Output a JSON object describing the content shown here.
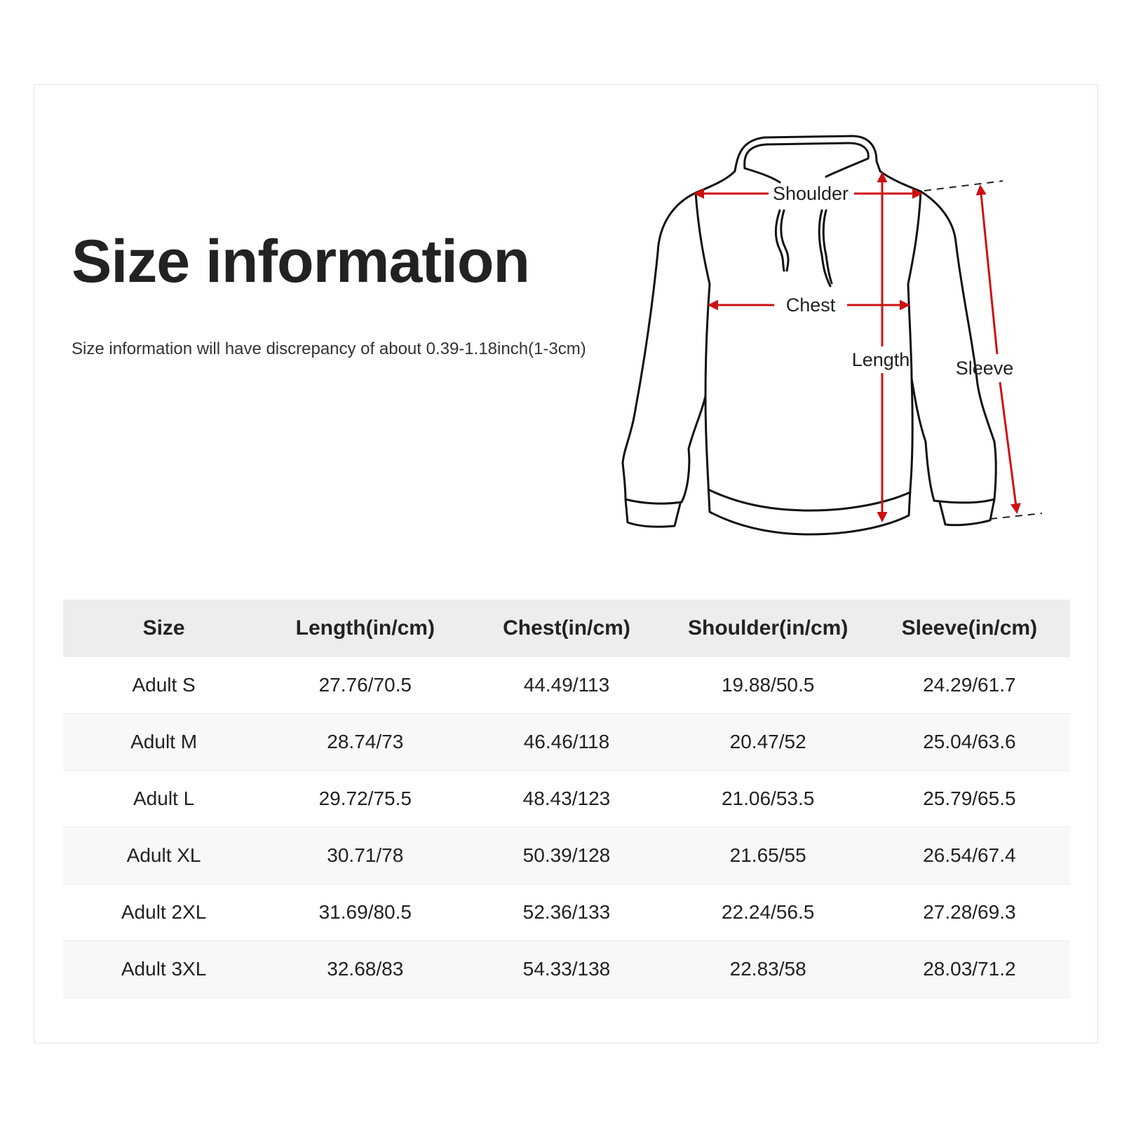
{
  "title": "Size information",
  "subtitle": "Size information will have discrepancy of about 0.39-1.18inch(1-3cm)",
  "diagram": {
    "labels": {
      "shoulder": "Shoulder",
      "chest": "Chest",
      "length": "Length",
      "sleeve": "Sleeve"
    },
    "arrow_color": "#cc1111",
    "outline_color": "#111111"
  },
  "table": {
    "headers": [
      "Size",
      "Length(in/cm)",
      "Chest(in/cm)",
      "Shoulder(in/cm)",
      "Sleeve(in/cm)"
    ],
    "rows": [
      [
        "Adult S",
        "27.76/70.5",
        "44.49/113",
        "19.88/50.5",
        "24.29/61.7"
      ],
      [
        "Adult M",
        "28.74/73",
        "46.46/118",
        "20.47/52",
        "25.04/63.6"
      ],
      [
        "Adult L",
        "29.72/75.5",
        "48.43/123",
        "21.06/53.5",
        "25.79/65.5"
      ],
      [
        "Adult XL",
        "30.71/78",
        "50.39/128",
        "21.65/55",
        "26.54/67.4"
      ],
      [
        "Adult 2XL",
        "31.69/80.5",
        "52.36/133",
        "22.24/56.5",
        "27.28/69.3"
      ],
      [
        "Adult 3XL",
        "32.68/83",
        "54.33/138",
        "22.83/58",
        "28.03/71.2"
      ]
    ],
    "header_bg": "#ededed",
    "stripe_bg": "#f8f8f8"
  }
}
